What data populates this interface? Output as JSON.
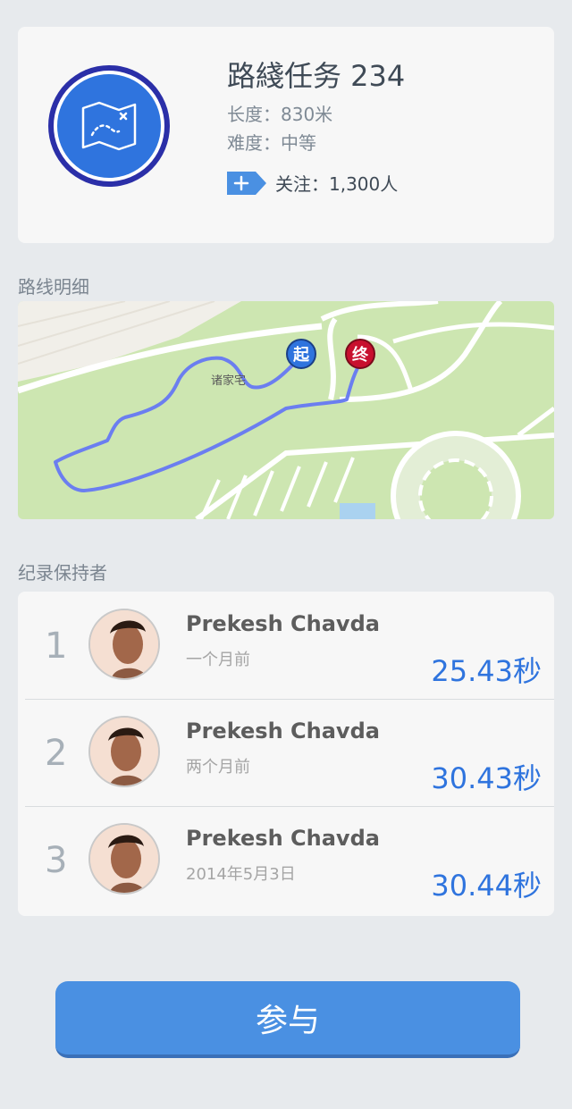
{
  "route": {
    "title": "路綫任务 234",
    "length": "长度：830米",
    "difficulty": "难度：中等",
    "follow_label": "关注：1,300人",
    "follow_icon": "plus-icon",
    "badge_icon": "map-icon"
  },
  "sections": {
    "route_detail": "路线明细",
    "record_holders": "纪录保持者"
  },
  "map": {
    "place_label": "诸家宅",
    "start_marker": "起",
    "end_marker": "终"
  },
  "records": [
    {
      "rank": "1",
      "name": "Prekesh Chavda",
      "when": "一个月前",
      "time": "25.43秒"
    },
    {
      "rank": "2",
      "name": "Prekesh Chavda",
      "when": "两个月前",
      "time": "30.43秒"
    },
    {
      "rank": "3",
      "name": "Prekesh Chavda",
      "when": "2014年5月3日",
      "time": "30.44秒"
    }
  ],
  "action": {
    "join_label": "参与"
  },
  "colors": {
    "accent": "#2f74de",
    "button": "#4a90e2",
    "start_marker": "#2f74de",
    "end_marker": "#c8102e",
    "route_line": "#6b7ef0"
  }
}
